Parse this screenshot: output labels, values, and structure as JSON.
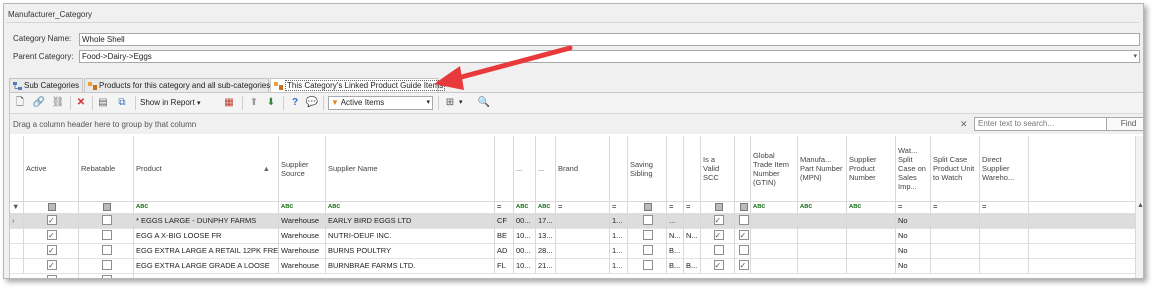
{
  "window": {
    "title": "Manufacturer_Category"
  },
  "form": {
    "category_name_label": "Category Name:",
    "category_name_value": "Whole Shell",
    "parent_category_label": "Parent Category:",
    "parent_category_value": "Food->Dairy->Eggs"
  },
  "tabs": [
    {
      "label": "Sub Categories"
    },
    {
      "label": "Products for this category and all sub-categories"
    },
    {
      "label": "This Category's Linked Product Guide Items"
    }
  ],
  "toolbar": {
    "show_in_report_label": "Show in Report",
    "filter_label": "Active Items"
  },
  "group_bar": {
    "hint": "Drag a column header here to group by that column",
    "search_placeholder": "Enter text to search...",
    "find_label": "Find"
  },
  "columns": {
    "active": "Active",
    "rebatable": "Rebatable",
    "product": "Product",
    "supplier_source": "Supplier Source",
    "supplier_name": "Supplier Name",
    "c6": "",
    "c7": "...",
    "c8": "...",
    "brand": "Brand",
    "saving_sibling": "Saving Sibling",
    "c11": "",
    "valid_scc": "Is a Valid SCC",
    "c13": "",
    "gtin": "Global Trade Item Number (GTIN)",
    "mpn": "Manufa... Part Number (MPN)",
    "supplier_product_number": "Supplier Product Number",
    "watch_split_case": "Wat... Split Case on Sales Imp...",
    "split_case_product": "Split Case Product Unit to Watch",
    "direct_supplier_warehouse": "Direct Supplier Wareho..."
  },
  "rows": [
    {
      "product": "* EGGS LARGE - DUNPHY FARMS",
      "source": "Warehouse",
      "supplier": "EARLY BIRD EGGS LTD",
      "c6": "CF",
      "c7": "00...",
      "c8": "17...",
      "brand": "",
      "c10": "1...",
      "c11": "",
      "c11b": "...",
      "watch": "No"
    },
    {
      "product": "EGG A X-BIG LOOSE FR",
      "source": "Warehouse",
      "supplier": "NUTRI-OEUF INC.",
      "c6": "BE",
      "c7": "10...",
      "c8": "13...",
      "brand": "",
      "c10": "1...",
      "c11": "",
      "c11b": "N...",
      "c11c": "N...",
      "watch": "No"
    },
    {
      "product": "EGG EXTRA LARGE A RETAIL 12PK FRE...",
      "source": "Warehouse",
      "supplier": "BURNS POULTRY",
      "c6": "AD",
      "c7": "00...",
      "c8": "28...",
      "brand": "",
      "c10": "1...",
      "c11": "",
      "c11b": "B...",
      "watch": "No"
    },
    {
      "product": "EGG EXTRA LARGE GRADE A LOOSE",
      "source": "Warehouse",
      "supplier": "BURNBRAE FARMS LTD.",
      "c6": "FL",
      "c7": "10...",
      "c8": "21...",
      "brand": "",
      "c10": "1...",
      "c11": "",
      "c11b": "B...",
      "c11c": "B...",
      "watch": "No"
    }
  ]
}
